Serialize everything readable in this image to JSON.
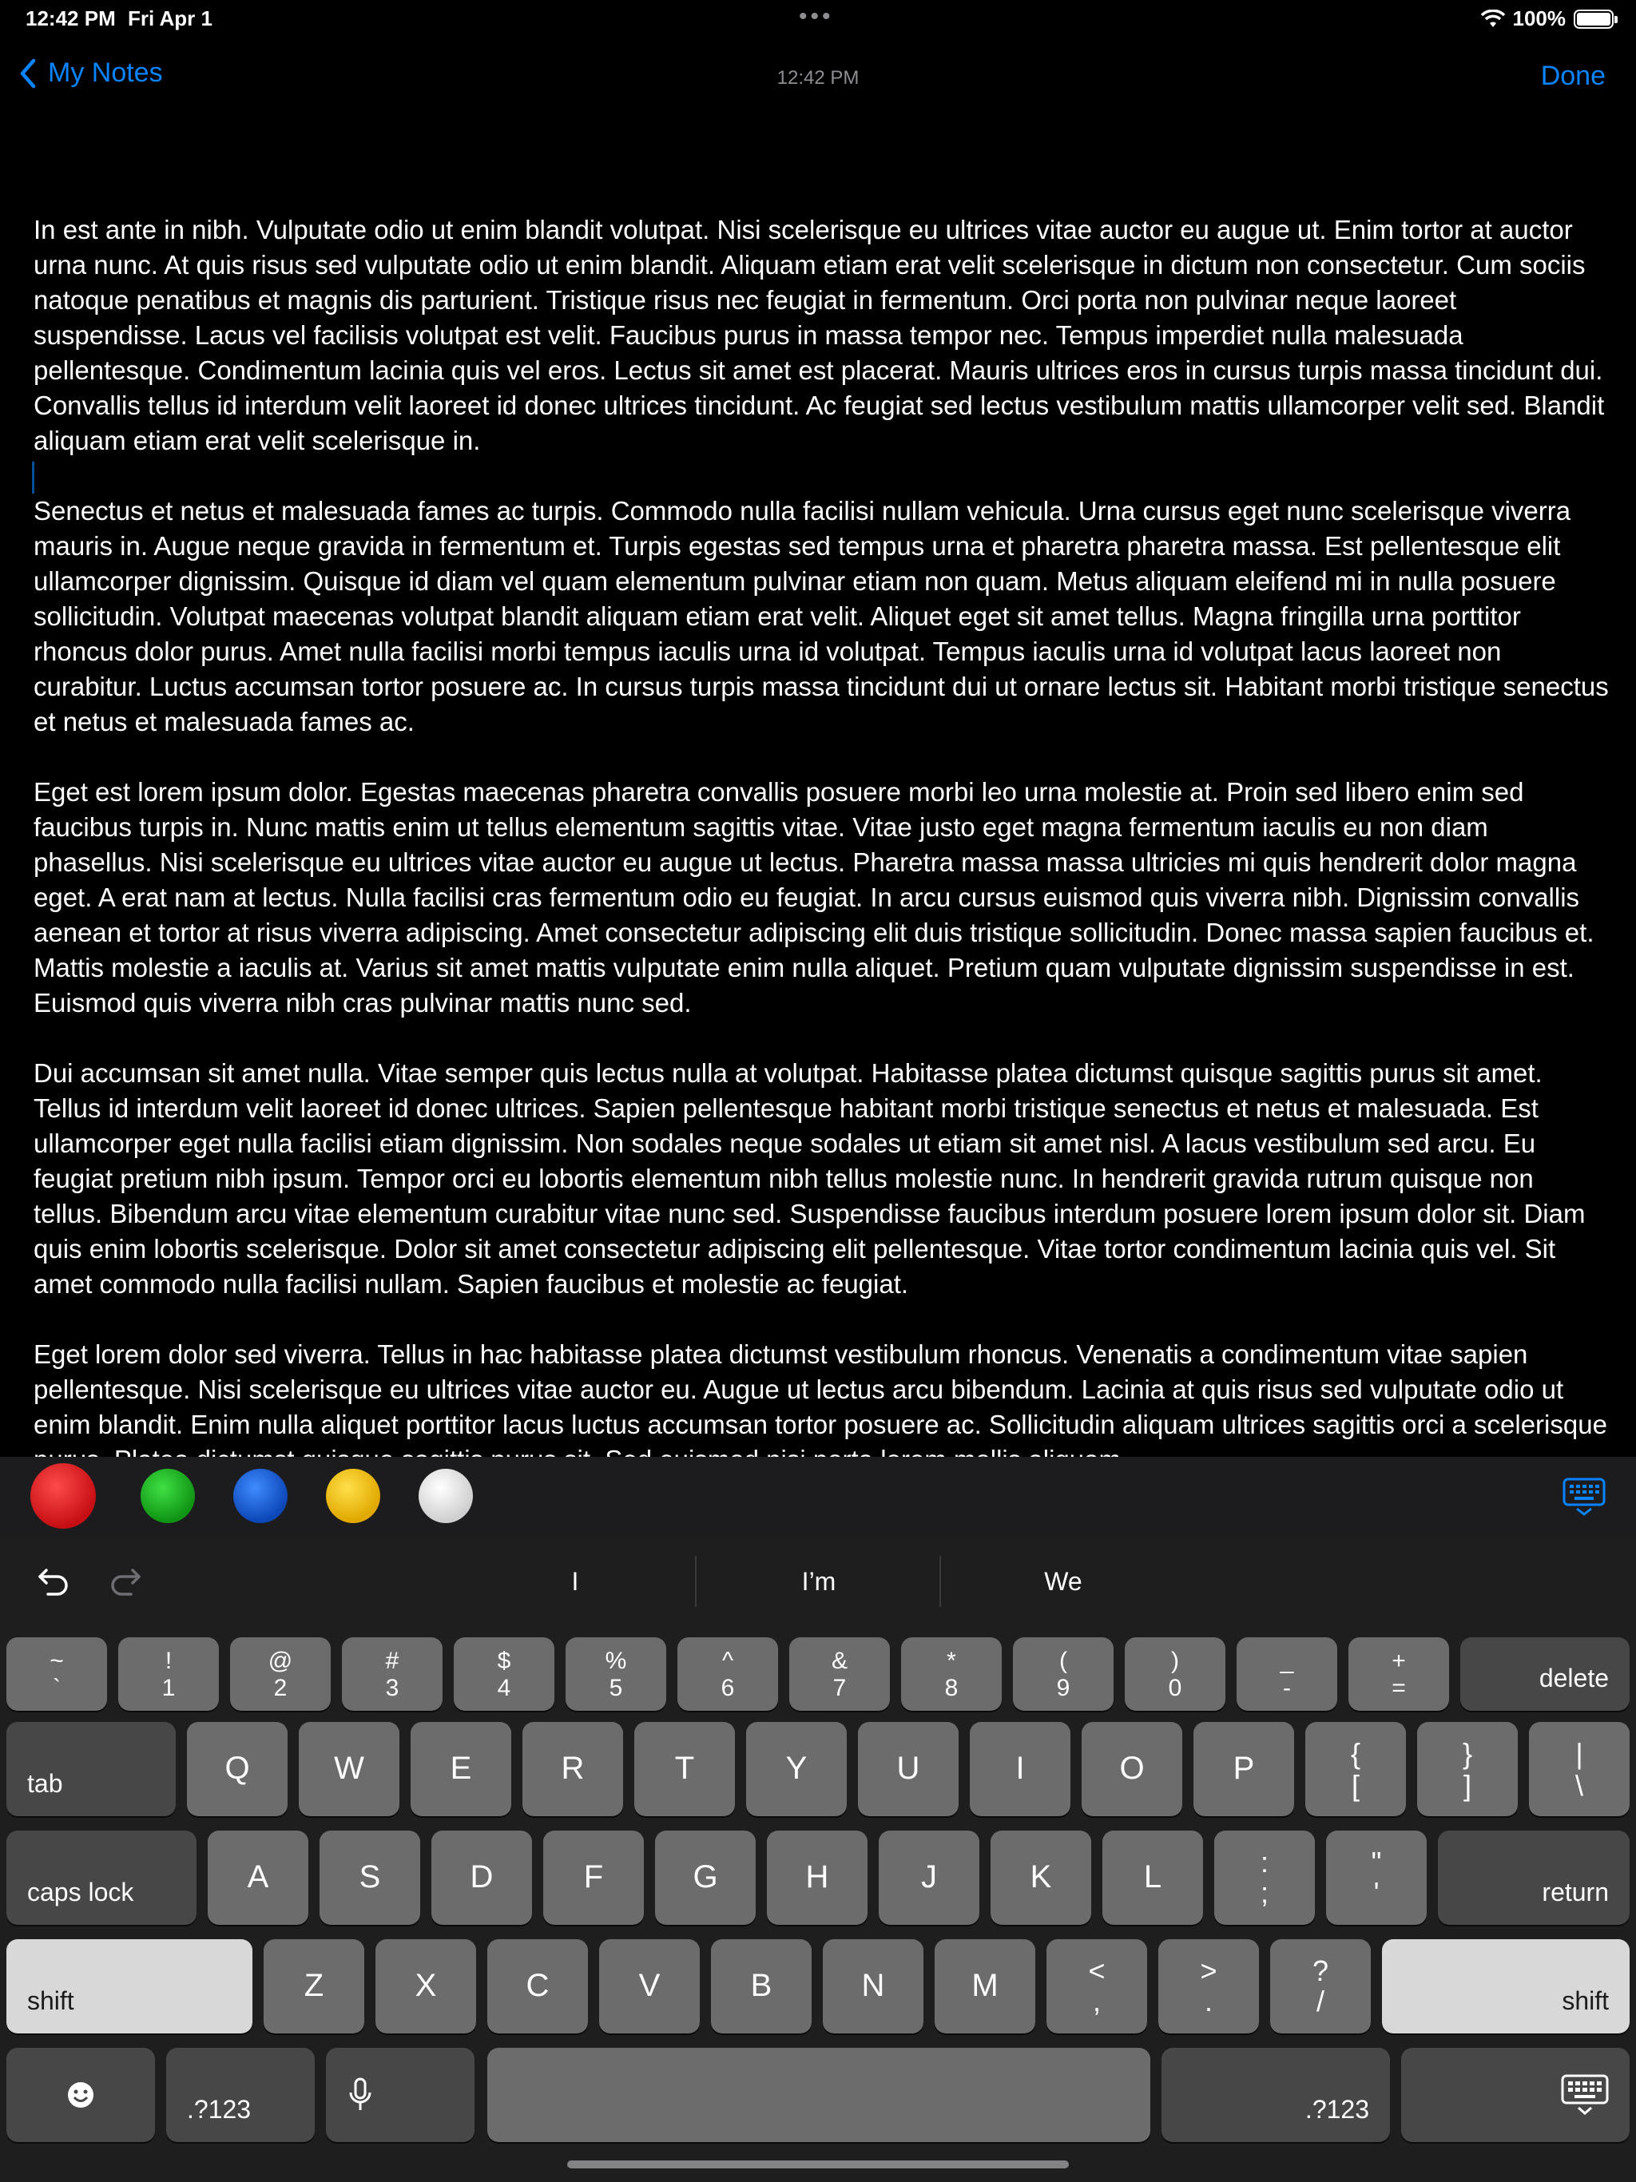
{
  "status": {
    "time": "12:42 PM",
    "date": "Fri Apr 1",
    "battery": "100%"
  },
  "nav": {
    "back_label": "My Notes",
    "timestamp": "12:42 PM",
    "done_label": "Done"
  },
  "note": {
    "paragraphs": [
      "In est ante in nibh. Vulputate odio ut enim blandit volutpat. Nisi scelerisque eu ultrices vitae auctor eu augue ut. Enim tortor at auctor urna nunc. At quis risus sed vulputate odio ut enim blandit. Aliquam etiam erat velit scelerisque in dictum non consectetur. Cum sociis natoque penatibus et magnis dis parturient. Tristique risus nec feugiat in fermentum. Orci porta non pulvinar neque laoreet suspendisse. Lacus vel facilisis volutpat est velit. Faucibus purus in massa tempor nec. Tempus imperdiet nulla malesuada pellentesque. Condimentum lacinia quis vel eros. Lectus sit amet est placerat. Mauris ultrices eros in cursus turpis massa tincidunt dui. Convallis tellus id interdum velit laoreet id donec ultrices tincidunt. Ac feugiat sed lectus vestibulum mattis ullamcorper velit sed. Blandit aliquam etiam erat velit scelerisque in.",
      "Senectus et netus et malesuada fames ac turpis. Commodo nulla facilisi nullam vehicula. Urna cursus eget nunc scelerisque viverra mauris in. Augue neque gravida in fermentum et. Turpis egestas sed tempus urna et pharetra pharetra massa. Est pellentesque elit ullamcorper dignissim. Quisque id diam vel quam elementum pulvinar etiam non quam. Metus aliquam eleifend mi in nulla posuere sollicitudin. Volutpat maecenas volutpat blandit aliquam etiam erat velit. Aliquet eget sit amet tellus. Magna fringilla urna porttitor rhoncus dolor purus. Amet nulla facilisi morbi tempus iaculis urna id volutpat. Tempus iaculis urna id volutpat lacus laoreet non curabitur. Luctus accumsan tortor posuere ac. In cursus turpis massa tincidunt dui ut ornare lectus sit. Habitant morbi tristique senectus et netus et malesuada fames ac.",
      "Eget est lorem ipsum dolor. Egestas maecenas pharetra convallis posuere morbi leo urna molestie at. Proin sed libero enim sed faucibus turpis in. Nunc mattis enim ut tellus elementum sagittis vitae. Vitae justo eget magna fermentum iaculis eu non diam phasellus. Nisi scelerisque eu ultrices vitae auctor eu augue ut lectus. Pharetra massa massa ultricies mi quis hendrerit dolor magna eget. A erat nam at lectus. Nulla facilisi cras fermentum odio eu feugiat. In arcu cursus euismod quis viverra nibh. Dignissim convallis aenean et tortor at risus viverra adipiscing. Amet consectetur adipiscing elit duis tristique sollicitudin. Donec massa sapien faucibus et. Mattis molestie a iaculis at. Varius sit amet mattis vulputate enim nulla aliquet. Pretium quam vulputate dignissim suspendisse in est. Euismod quis viverra nibh cras pulvinar mattis nunc sed.",
      "Dui accumsan sit amet nulla. Vitae semper quis lectus nulla at volutpat. Habitasse platea dictumst quisque sagittis purus sit amet. Tellus id interdum velit laoreet id donec ultrices. Sapien pellentesque habitant morbi tristique senectus et netus et malesuada. Est ullamcorper eget nulla facilisi etiam dignissim. Non sodales neque sodales ut etiam sit amet nisl. A lacus vestibulum sed arcu. Eu feugiat pretium nibh ipsum. Tempor orci eu lobortis elementum nibh tellus molestie nunc. In hendrerit gravida rutrum quisque non tellus. Bibendum arcu vitae elementum curabitur vitae nunc sed. Suspendisse faucibus interdum posuere lorem ipsum dolor sit. Diam quis enim lobortis scelerisque. Dolor sit amet consectetur adipiscing elit pellentesque. Vitae tortor condimentum lacinia quis vel. Sit amet commodo nulla facilisi nullam. Sapien faucibus et molestie ac feugiat.",
      "Eget lorem dolor sed viverra. Tellus in hac habitasse platea dictumst vestibulum rhoncus. Venenatis a condimentum vitae sapien pellentesque. Nisi scelerisque eu ultrices vitae auctor eu. Augue ut lectus arcu bibendum. Lacinia at quis risus sed vulputate odio ut enim blandit. Enim nulla aliquet porttitor lacus luctus accumsan tortor posuere ac. Sollicitudin aliquam ultrices sagittis orci a scelerisque purus. Platea dictumst quisque sagittis purus sit. Sed euismod nisi porta lorem mollis aliquam."
    ]
  },
  "palette": {
    "colors": [
      "#e0161b",
      "#17b21d",
      "#1463d8",
      "#f5c400",
      "#e6e6e6"
    ]
  },
  "keyboard": {
    "suggestions": [
      "I",
      "I’m",
      "We"
    ],
    "row1": [
      {
        "top": "~",
        "bottom": "`"
      },
      {
        "top": "!",
        "bottom": "1"
      },
      {
        "top": "@",
        "bottom": "2"
      },
      {
        "top": "#",
        "bottom": "3"
      },
      {
        "top": "$",
        "bottom": "4"
      },
      {
        "top": "%",
        "bottom": "5"
      },
      {
        "top": "^",
        "bottom": "6"
      },
      {
        "top": "&",
        "bottom": "7"
      },
      {
        "top": "*",
        "bottom": "8"
      },
      {
        "top": "(",
        "bottom": "9"
      },
      {
        "top": ")",
        "bottom": "0"
      },
      {
        "top": "_",
        "bottom": "-"
      },
      {
        "top": "+",
        "bottom": "="
      }
    ],
    "delete": "delete",
    "tab": "tab",
    "row2": [
      "Q",
      "W",
      "E",
      "R",
      "T",
      "Y",
      "U",
      "I",
      "O",
      "P"
    ],
    "row2_sym": [
      {
        "top": "{",
        "bottom": "["
      },
      {
        "top": "}",
        "bottom": "]"
      },
      {
        "top": "|",
        "bottom": "\\"
      }
    ],
    "caps": "caps lock",
    "row3": [
      "A",
      "S",
      "D",
      "F",
      "G",
      "H",
      "J",
      "K",
      "L"
    ],
    "row3_sym": [
      {
        "top": ":",
        "bottom": ";"
      },
      {
        "top": "\"",
        "bottom": "'"
      }
    ],
    "return": "return",
    "shift": "shift",
    "row4": [
      "Z",
      "X",
      "C",
      "V",
      "B",
      "N",
      "M"
    ],
    "row4_sym": [
      {
        "top": "<",
        "bottom": ","
      },
      {
        "top": ">",
        "bottom": "."
      },
      {
        "top": "?",
        "bottom": "/"
      }
    ],
    "numbers_label": ".?123"
  }
}
